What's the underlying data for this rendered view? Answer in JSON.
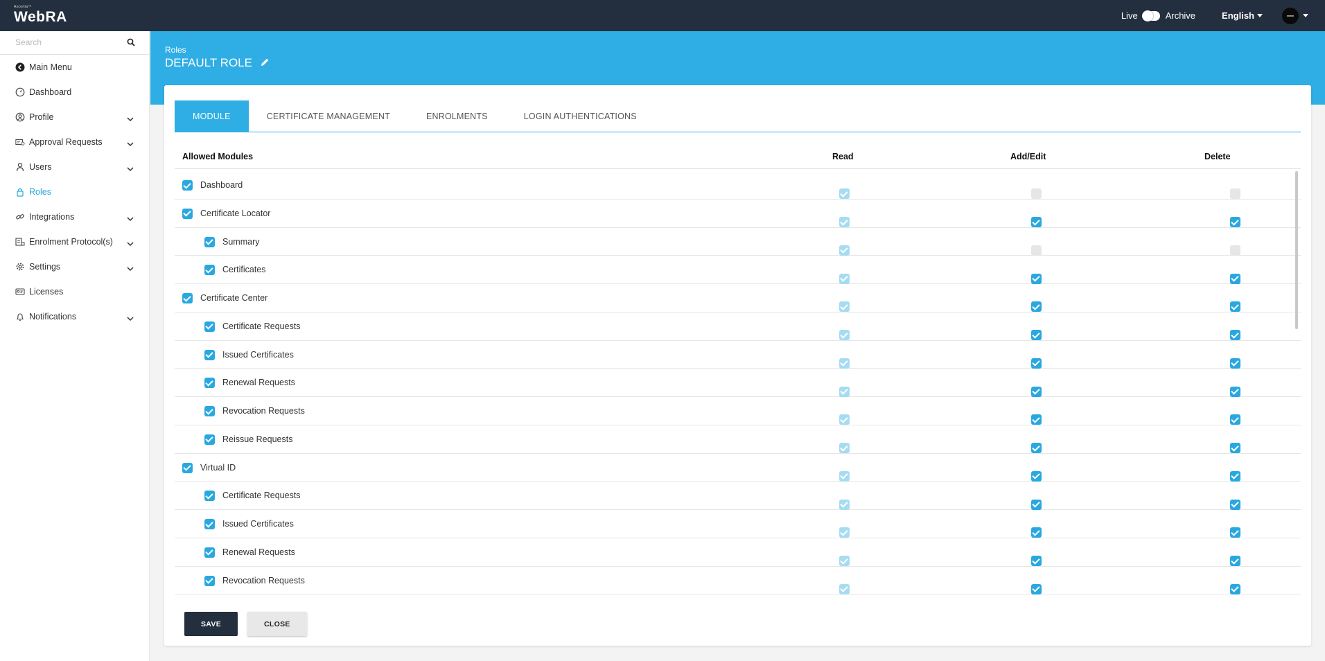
{
  "topbar": {
    "brand_small": "Ascertia™",
    "brand_name": "WebRA",
    "live_label": "Live",
    "archive_label": "Archive",
    "language": "English"
  },
  "sidebar": {
    "search_placeholder": "Search",
    "items": [
      {
        "label": "Main Menu",
        "icon": "back-circle-icon",
        "expandable": false
      },
      {
        "label": "Dashboard",
        "icon": "dashboard-icon",
        "expandable": false
      },
      {
        "label": "Profile",
        "icon": "profile-icon",
        "expandable": true
      },
      {
        "label": "Approval Requests",
        "icon": "approval-icon",
        "expandable": true
      },
      {
        "label": "Users",
        "icon": "users-icon",
        "expandable": true
      },
      {
        "label": "Roles",
        "icon": "lock-icon",
        "expandable": false,
        "active": true
      },
      {
        "label": "Integrations",
        "icon": "link-icon",
        "expandable": true
      },
      {
        "label": "Enrolment Protocol(s)",
        "icon": "protocol-icon",
        "expandable": true
      },
      {
        "label": "Settings",
        "icon": "gear-icon",
        "expandable": true
      },
      {
        "label": "Licenses",
        "icon": "license-icon",
        "expandable": false
      },
      {
        "label": "Notifications",
        "icon": "bell-icon",
        "expandable": true
      }
    ]
  },
  "header": {
    "breadcrumb": "Roles",
    "title": "DEFAULT ROLE"
  },
  "tabs": [
    "MODULE",
    "CERTIFICATE MANAGEMENT",
    "ENROLMENTS",
    "LOGIN AUTHENTICATIONS"
  ],
  "active_tab": "MODULE",
  "table": {
    "columns": {
      "module": "Allowed Modules",
      "read": "Read",
      "add_edit": "Add/Edit",
      "delete": "Delete"
    },
    "rows": [
      {
        "label": "Dashboard",
        "level": 0,
        "allowed": true,
        "read": "faded",
        "add_edit": "off",
        "delete": "off"
      },
      {
        "label": "Certificate Locator",
        "level": 0,
        "allowed": true,
        "read": "faded",
        "add_edit": "on",
        "delete": "on"
      },
      {
        "label": "Summary",
        "level": 1,
        "allowed": true,
        "read": "faded",
        "add_edit": "off",
        "delete": "off"
      },
      {
        "label": "Certificates",
        "level": 1,
        "allowed": true,
        "read": "faded",
        "add_edit": "on",
        "delete": "on"
      },
      {
        "label": "Certificate Center",
        "level": 0,
        "allowed": true,
        "read": "faded",
        "add_edit": "on",
        "delete": "on"
      },
      {
        "label": "Certificate Requests",
        "level": 1,
        "allowed": true,
        "read": "faded",
        "add_edit": "on",
        "delete": "on"
      },
      {
        "label": "Issued Certificates",
        "level": 1,
        "allowed": true,
        "read": "faded",
        "add_edit": "on",
        "delete": "on"
      },
      {
        "label": "Renewal Requests",
        "level": 1,
        "allowed": true,
        "read": "faded",
        "add_edit": "on",
        "delete": "on"
      },
      {
        "label": "Revocation Requests",
        "level": 1,
        "allowed": true,
        "read": "faded",
        "add_edit": "on",
        "delete": "on"
      },
      {
        "label": "Reissue Requests",
        "level": 1,
        "allowed": true,
        "read": "faded",
        "add_edit": "on",
        "delete": "on"
      },
      {
        "label": "Virtual ID",
        "level": 0,
        "allowed": true,
        "read": "faded",
        "add_edit": "on",
        "delete": "on"
      },
      {
        "label": "Certificate Requests",
        "level": 1,
        "allowed": true,
        "read": "faded",
        "add_edit": "on",
        "delete": "on"
      },
      {
        "label": "Issued Certificates",
        "level": 1,
        "allowed": true,
        "read": "faded",
        "add_edit": "on",
        "delete": "on"
      },
      {
        "label": "Renewal Requests",
        "level": 1,
        "allowed": true,
        "read": "faded",
        "add_edit": "on",
        "delete": "on"
      },
      {
        "label": "Revocation Requests",
        "level": 1,
        "allowed": true,
        "read": "faded",
        "add_edit": "on",
        "delete": "on"
      }
    ]
  },
  "buttons": {
    "save": "SAVE",
    "close": "CLOSE"
  },
  "colors": {
    "topbar": "#232f3e",
    "accent": "#2eaee4",
    "checkbox_on": "#29a8e0",
    "checkbox_faded": "#a6dcf2",
    "checkbox_off": "#e6e6e6"
  }
}
